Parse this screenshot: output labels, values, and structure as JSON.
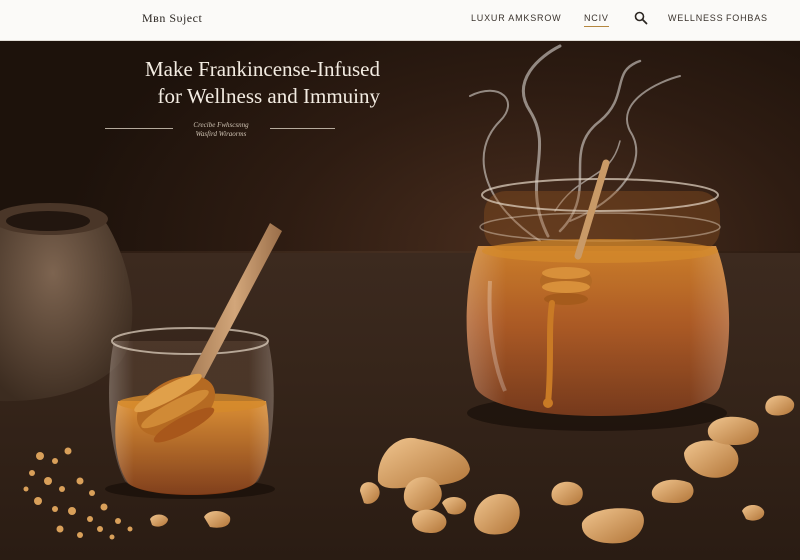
{
  "header": {
    "brand": "Mʙn Sυjeсt",
    "nav": [
      "LUXUR AMKSROW",
      "NCIV",
      "WELLNESS",
      "FOHBAS"
    ],
    "active_nav_index": 1,
    "search_icon": "search-icon"
  },
  "hero": {
    "headline_line1": "Make Frankincense-Infused",
    "headline_line2": "for Wellness and Immuiny",
    "tagline_line1": "Crecibe Fwhscsnng",
    "tagline_line2": "Wasfird Wiraorms"
  },
  "colors": {
    "header_bg": "#fbfaf8",
    "accent": "#b5873f",
    "honey": "#b3631b",
    "background": "#2a1a10"
  }
}
